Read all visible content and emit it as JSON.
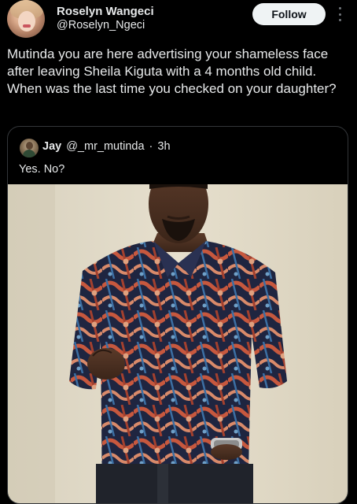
{
  "post": {
    "author_name": "Roselyn Wangeci",
    "author_handle": "@Roselyn_Ngeci",
    "follow_label": "Follow",
    "text": "Mutinda you are here advertising your shameless face after leaving Sheila Kiguta with a 4 months old child. When was the last time you checked on your daughter?"
  },
  "quote": {
    "author_name": "Jay",
    "author_handle": "@_mr_mutinda",
    "separator": "·",
    "time": "3h",
    "text": "Yes. No?"
  },
  "colors": {
    "background": "#000000",
    "text": "#e7e9ea",
    "follow_button_bg": "#eff3f4",
    "card_border": "#333639"
  },
  "icons": {
    "more": "more-vertical-icon"
  }
}
